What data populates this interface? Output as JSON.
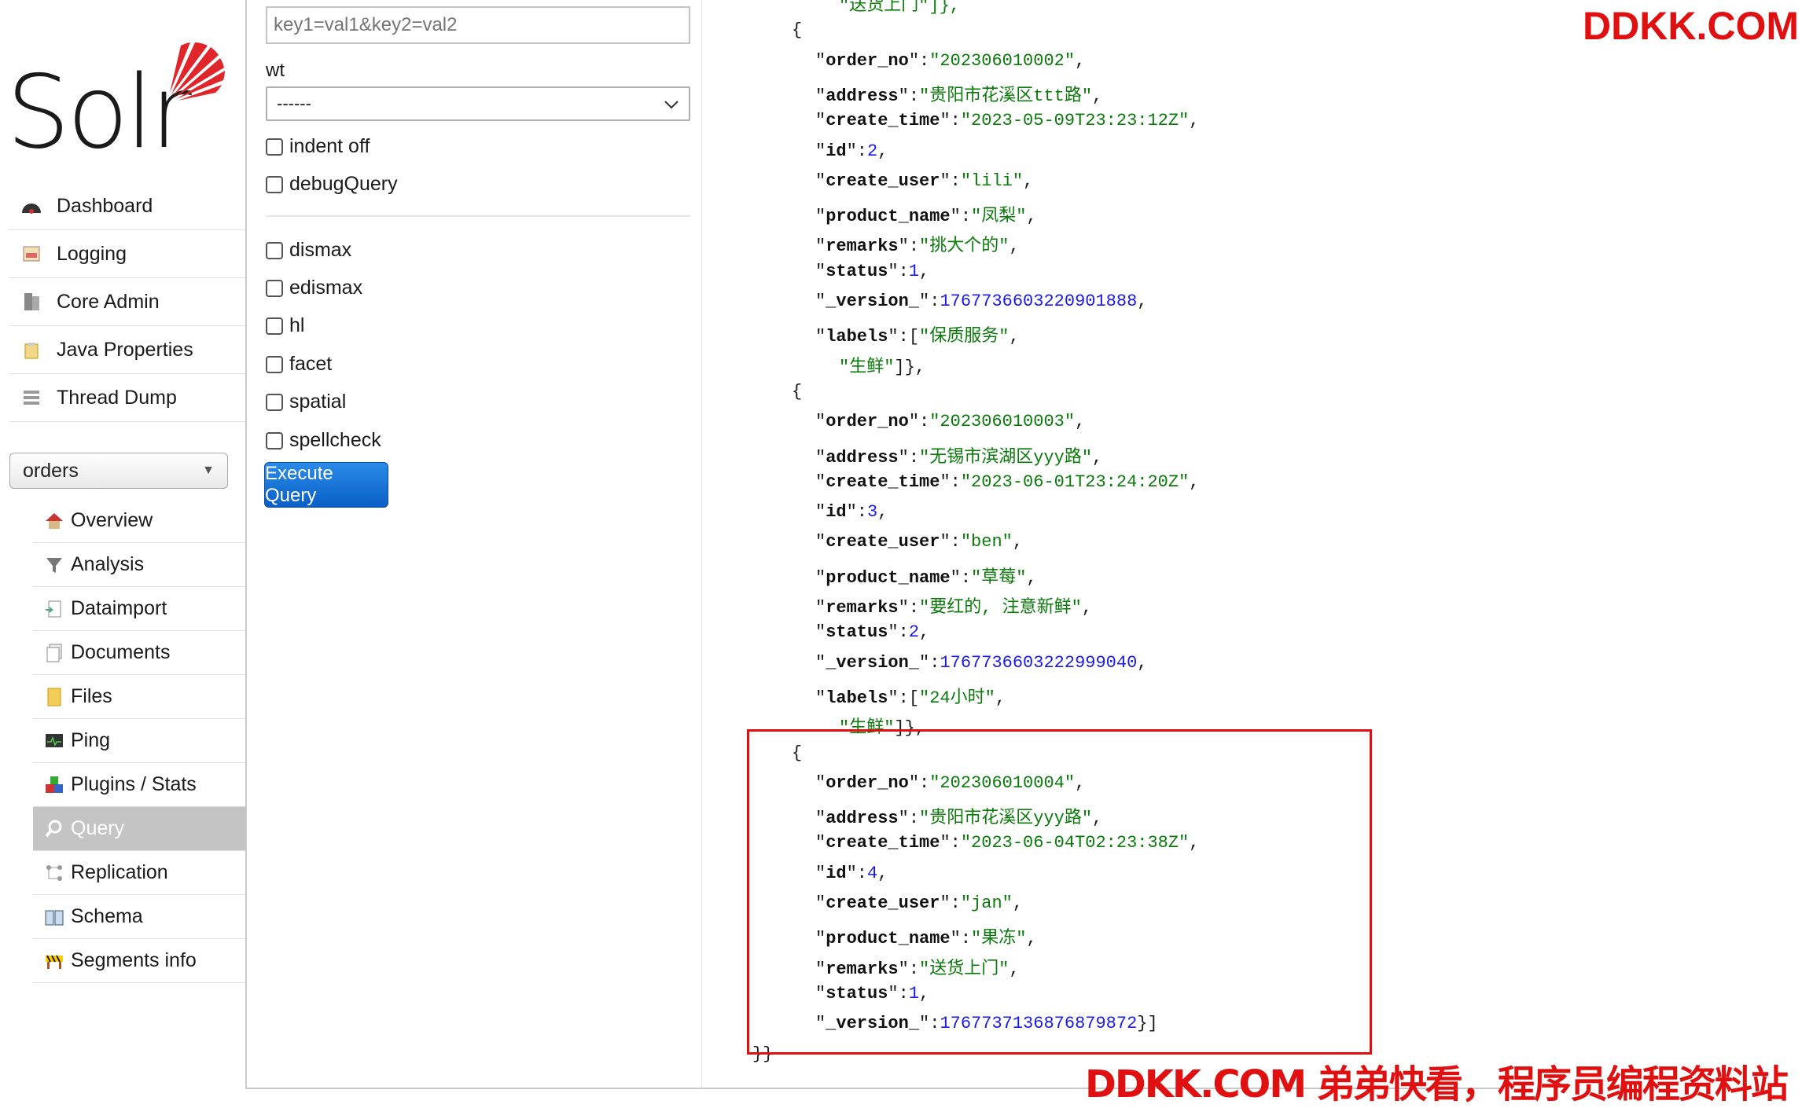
{
  "logo": {
    "text": "Solr"
  },
  "nav": {
    "items": [
      {
        "label": "Dashboard",
        "icon": "dashboard-icon"
      },
      {
        "label": "Logging",
        "icon": "logging-icon"
      },
      {
        "label": "Core Admin",
        "icon": "core-admin-icon"
      },
      {
        "label": "Java Properties",
        "icon": "java-properties-icon"
      },
      {
        "label": "Thread Dump",
        "icon": "thread-dump-icon"
      }
    ],
    "core_selector": {
      "value": "orders"
    },
    "core_items": [
      {
        "label": "Overview",
        "icon": "home-icon"
      },
      {
        "label": "Analysis",
        "icon": "funnel-icon"
      },
      {
        "label": "Dataimport",
        "icon": "dataimport-icon"
      },
      {
        "label": "Documents",
        "icon": "documents-icon"
      },
      {
        "label": "Files",
        "icon": "folder-icon"
      },
      {
        "label": "Ping",
        "icon": "ping-icon"
      },
      {
        "label": "Plugins / Stats",
        "icon": "plugins-icon"
      },
      {
        "label": "Query",
        "icon": "magnifier-icon",
        "active": true
      },
      {
        "label": "Replication",
        "icon": "replication-icon"
      },
      {
        "label": "Schema",
        "icon": "schema-book-icon"
      },
      {
        "label": "Segments info",
        "icon": "segments-icon"
      }
    ]
  },
  "form": {
    "raw_params_placeholder": "key1=val1&key2=val2",
    "wt_label": "wt",
    "wt_value": "------",
    "options": [
      "indent off",
      "debugQuery"
    ],
    "parsers": [
      "dismax",
      "edismax",
      "hl",
      "facet",
      "spatial",
      "spellcheck"
    ],
    "execute_label": "Execute Query"
  },
  "results": {
    "top_fragment": "\"送货上门\"]},",
    "docs": [
      {
        "fields": [
          [
            "order_no",
            "\"202306010002\""
          ],
          [
            "address",
            "\"贵阳市花溪区ttt路\""
          ],
          [
            "create_time",
            "\"2023-05-09T23:23:12Z\""
          ],
          [
            "id",
            "2"
          ],
          [
            "create_user",
            "\"lili\""
          ],
          [
            "product_name",
            "\"凤梨\""
          ],
          [
            "remarks",
            "\"挑大个的\""
          ],
          [
            "status",
            "1"
          ],
          [
            "_version_",
            "1767736603220901888"
          ]
        ],
        "labels": [
          "\"保质服务\"",
          "\"生鲜\""
        ]
      },
      {
        "fields": [
          [
            "order_no",
            "\"202306010003\""
          ],
          [
            "address",
            "\"无锡市滨湖区yyy路\""
          ],
          [
            "create_time",
            "\"2023-06-01T23:24:20Z\""
          ],
          [
            "id",
            "3"
          ],
          [
            "create_user",
            "\"ben\""
          ],
          [
            "product_name",
            "\"草莓\""
          ],
          [
            "remarks",
            "\"要红的, 注意新鲜\""
          ],
          [
            "status",
            "2"
          ],
          [
            "_version_",
            "1767736603222999040"
          ]
        ],
        "labels": [
          "\"24小时\"",
          "\"生鲜\""
        ]
      },
      {
        "fields": [
          [
            "order_no",
            "\"202306010004\""
          ],
          [
            "address",
            "\"贵阳市花溪区yyy路\""
          ],
          [
            "create_time",
            "\"2023-06-04T02:23:38Z\""
          ],
          [
            "id",
            "4"
          ],
          [
            "create_user",
            "\"jan\""
          ],
          [
            "product_name",
            "\"果冻\""
          ],
          [
            "remarks",
            "\"送货上门\""
          ],
          [
            "status",
            "1"
          ],
          [
            "_version_",
            "1767737136876879872"
          ]
        ],
        "labels": []
      }
    ],
    "closing": "}}"
  },
  "watermarks": {
    "top": "DDKK.COM",
    "bottom": "DDKK.COM 弟弟快看，程序员编程资料站"
  },
  "colors": {
    "accent_blue": "#0a5fc6",
    "watermark_red": "#e01010",
    "json_string": "#0a7a0a",
    "json_number": "#1a1aee"
  }
}
